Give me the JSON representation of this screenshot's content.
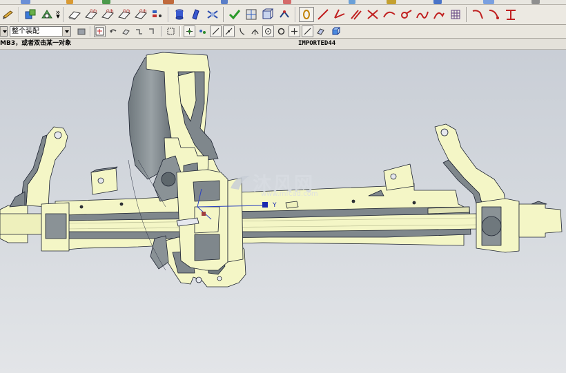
{
  "toolbar": {
    "assembly_filter_value": "整个装配",
    "overflow_glyph": "»"
  },
  "status": {
    "prompt": "MB3，或者双击某一对象",
    "part_name": "IMPORTED44"
  },
  "viewport": {
    "axis_label_y": "Y",
    "watermark_text": "沐风网",
    "watermark_url": "www.mfcad.com"
  },
  "colors": {
    "part_fill": "#f4f6c6",
    "part_shadow": "#7f878c",
    "edge": "#1c2230",
    "background_top": "#c9ced6",
    "background_bottom": "#e3e5e8"
  },
  "icons": {
    "row1": [
      "pencil-icon",
      "add-component-icon",
      "mate-constraint-icon",
      "overflow-icon",
      "shade-face-icon",
      "edge-blend-icon",
      "color-edit-icon",
      "face-color-icon",
      "variable-blend-icon",
      "layer-list-icon",
      "cylinder-icon",
      "pattern-icon",
      "measure-icon",
      "analysis-icon",
      "section-icon",
      "wireframe-box-icon",
      "snap-point-icon",
      "line-icon",
      "angle-line-icon",
      "parallel-icon",
      "cross-icon",
      "curve-icon",
      "spline-icon",
      "trim-icon",
      "bridge-icon",
      "hatch-icon",
      "arc-icon",
      "fillet-arc-icon",
      "offset-curve-icon"
    ],
    "row2": [
      "component-icon",
      "undo-icon",
      "shapes-icon",
      "link-icon",
      "select-box-icon",
      "point-icon",
      "vertex-snap-icon",
      "endpoint-icon",
      "midpoint-icon",
      "curve-snap-icon",
      "quadrant-icon",
      "center-icon",
      "arc-center-icon",
      "plus-icon",
      "on-curve-icon",
      "face-snap-icon",
      "solid-body-icon"
    ]
  }
}
